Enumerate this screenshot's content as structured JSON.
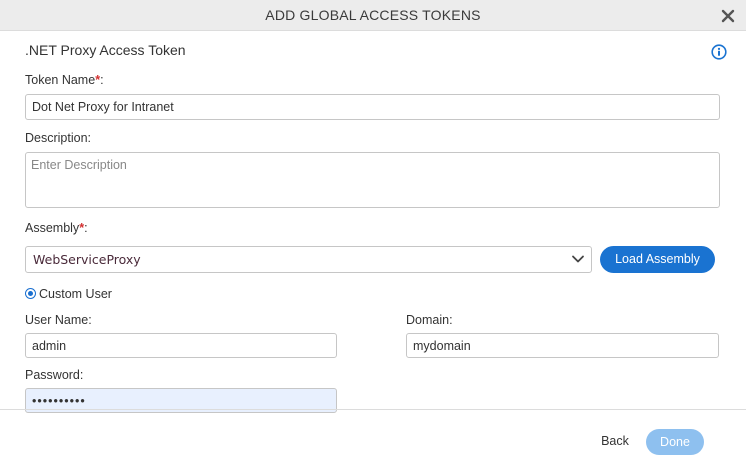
{
  "dialog": {
    "title": "ADD GLOBAL ACCESS TOKENS"
  },
  "section": {
    "title": ".NET Proxy Access Token"
  },
  "token_name": {
    "label": "Token Name",
    "required_mark": "*",
    "label_suffix": ":",
    "value": "Dot Net Proxy for Intranet"
  },
  "description": {
    "label": "Description:",
    "placeholder": "Enter Description",
    "value": ""
  },
  "assembly": {
    "label": "Assembly",
    "required_mark": "*",
    "label_suffix": ":",
    "selected": "WebServiceProxy",
    "load_button": "Load Assembly"
  },
  "custom_user": {
    "label": "Custom User",
    "selected": true
  },
  "user_name": {
    "label": "User Name:",
    "value": "admin"
  },
  "domain": {
    "label": "Domain:",
    "value": "mydomain"
  },
  "password": {
    "label": "Password:",
    "value": "••••••••••"
  },
  "footer": {
    "back_label": "Back",
    "done_label": "Done"
  },
  "icons": {
    "close": "close-icon",
    "info": "info-icon",
    "dropdown": "chevron-down-icon"
  },
  "colors": {
    "accent": "#1a73d1",
    "done_disabled": "#8ec0ef",
    "required": "#d32f2f",
    "header_bg": "#ececec",
    "password_bg": "#e8f0fe"
  }
}
